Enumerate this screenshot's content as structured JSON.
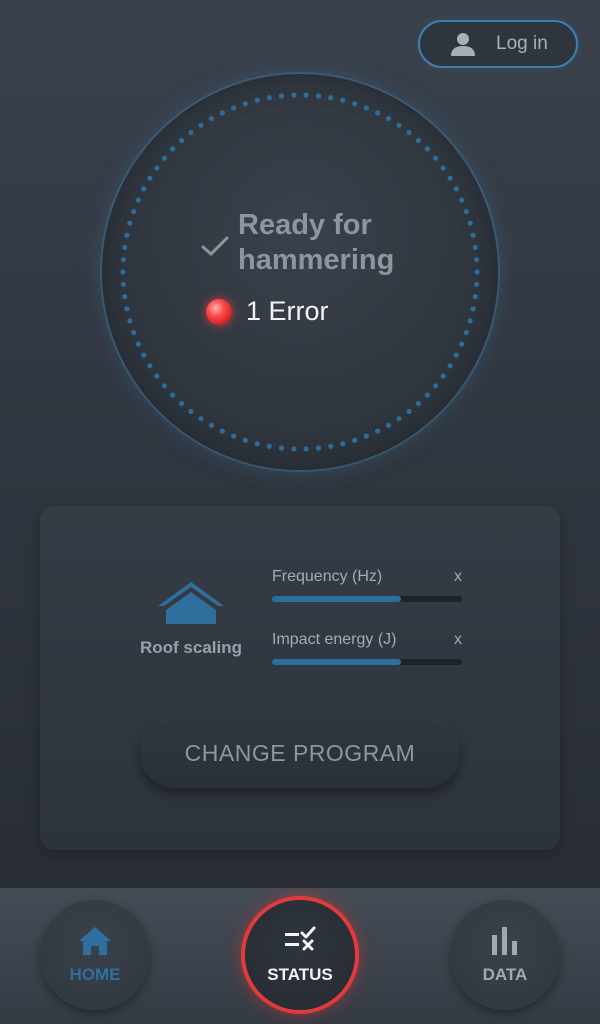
{
  "header": {
    "login_label": "Log in",
    "login_icon": "user-icon"
  },
  "status": {
    "ready_text": "Ready for hammering",
    "error_text": "1 Error",
    "accent_color": "#3d7fae",
    "error_color": "#ff4a4a"
  },
  "program": {
    "mode_label": "Roof scaling",
    "mode_icon": "house-icon",
    "params": [
      {
        "label": "Frequency (Hz)",
        "value": "x",
        "level": 0.68
      },
      {
        "label": "Impact energy (J)",
        "value": "x",
        "level": 0.68
      }
    ],
    "change_button_label": "CHANGE PROGRAM"
  },
  "nav": {
    "items": [
      {
        "label": "HOME",
        "icon": "home-icon",
        "active": false
      },
      {
        "label": "STATUS",
        "icon": "checklist-icon",
        "active": true
      },
      {
        "label": "DATA",
        "icon": "bar-chart-icon",
        "active": false
      }
    ]
  }
}
